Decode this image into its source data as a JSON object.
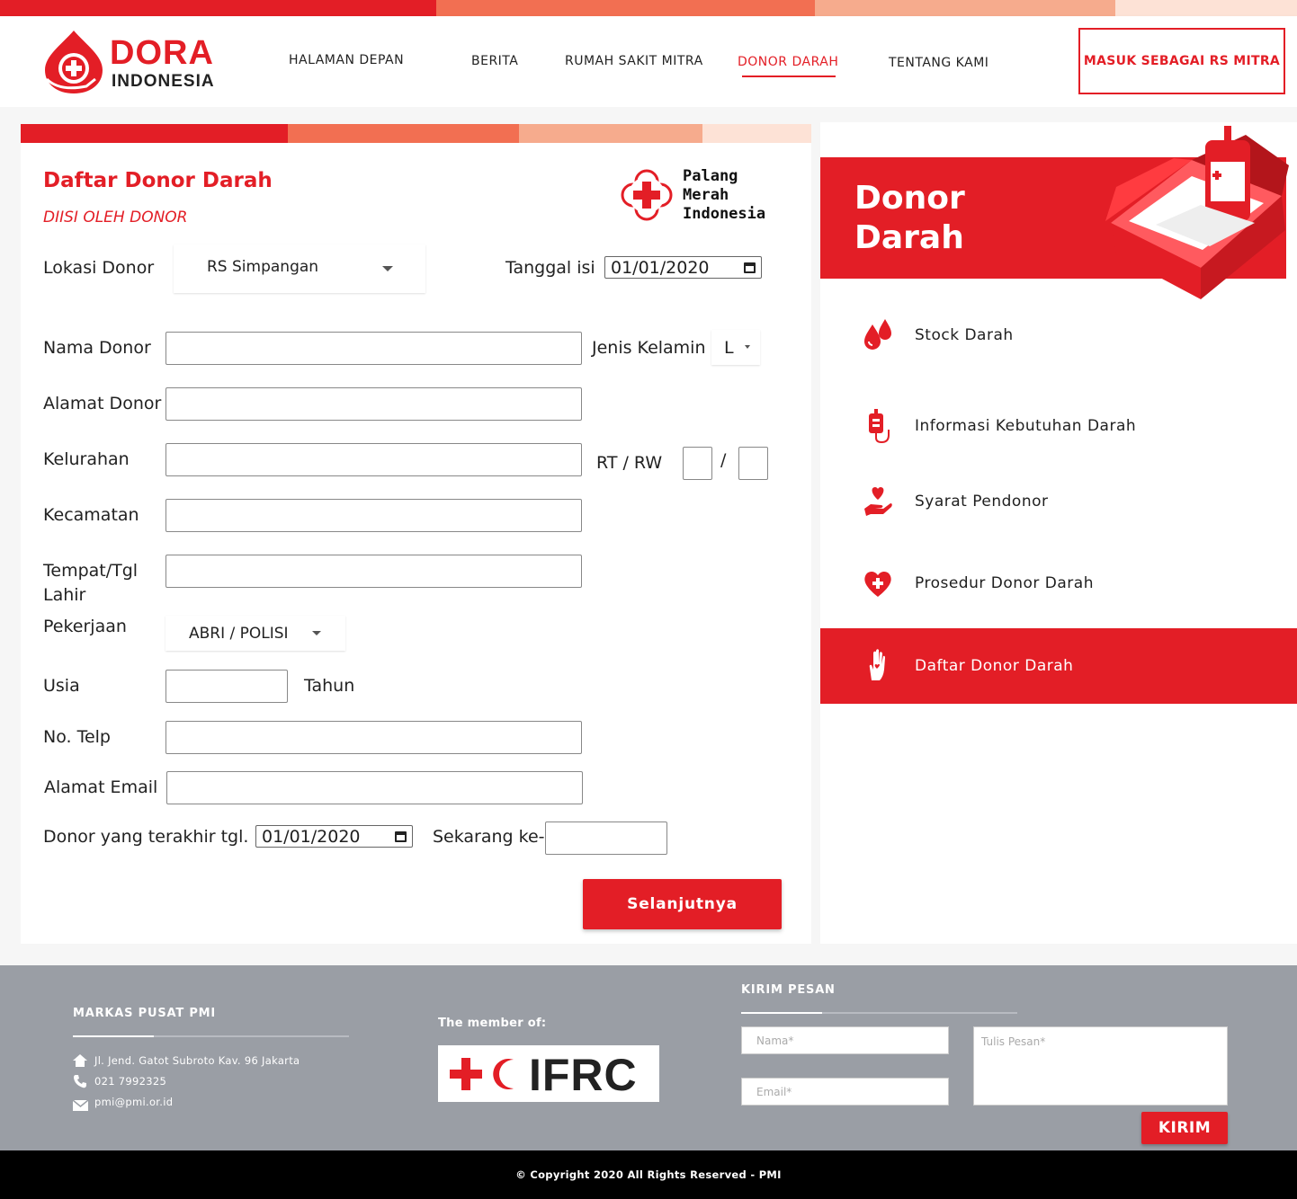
{
  "brand": {
    "name_line1": "DORA",
    "name_line2": "INDONESIA",
    "colors": {
      "primary": "#e31e26",
      "orange": "#f26f52",
      "peach": "#f6ab8d",
      "light": "#fde2d6",
      "footer_gray": "#9a9ea5"
    }
  },
  "nav": {
    "items": [
      {
        "label": "HALAMAN DEPAN"
      },
      {
        "label": "BERITA"
      },
      {
        "label": "RUMAH SAKIT MITRA"
      },
      {
        "label": "DONOR DARAH"
      },
      {
        "label": "TENTANG KAMI"
      }
    ],
    "active": "DONOR DARAH",
    "cta_label": "MASUK SEBAGAI RS MITRA"
  },
  "form": {
    "title": "Daftar Donor Darah",
    "subtitle": "DIISI OLEH DONOR",
    "org_logo": {
      "line1": "Palang",
      "line2": "Merah",
      "line3": "Indonesia"
    },
    "lokasi_label": "Lokasi Donor",
    "lokasi_value": "RS Simpangan",
    "tanggal_label": "Tanggal isi",
    "tanggal_value": "01/01/2020",
    "nama_label": "Nama Donor",
    "jk_label": "Jenis Kelamin",
    "jk_value": "L",
    "alamat_label": "Alamat Donor",
    "kelurahan_label": "Kelurahan",
    "rtrw_label": "RT / RW",
    "rtrw_sep": "/",
    "kecamatan_label": "Kecamatan",
    "ttl_label_1": "Tempat/Tgl",
    "ttl_label_2": "Lahir",
    "pekerjaan_label": "Pekerjaan",
    "pekerjaan_value": "ABRI / POLISI",
    "usia_label": "Usia",
    "usia_unit": "Tahun",
    "telp_label": "No. Telp",
    "email_label": "Alamat Email",
    "terakhir_label": "Donor yang terakhir tgl.",
    "terakhir_value": "01/01/2020",
    "sekarang_label": "Sekarang ke-",
    "submit_label": "Selanjutnya"
  },
  "sidebar": {
    "banner_title_1": "Donor",
    "banner_title_2": "Darah",
    "items": [
      {
        "label": "Stock Darah",
        "icon": "blood-drops-icon"
      },
      {
        "label": "Informasi Kebutuhan Darah",
        "icon": "blood-bag-icon"
      },
      {
        "label": "Syarat Pendonor",
        "icon": "heart-hand-icon"
      },
      {
        "label": "Prosedur Donor Darah",
        "icon": "heart-cross-icon"
      },
      {
        "label": "Daftar Donor Darah",
        "icon": "hand-icon",
        "active": true
      }
    ]
  },
  "footer": {
    "hq_title": "MARKAS PUSAT PMI",
    "address": "Jl. Jend. Gatot Subroto Kav. 96 Jakarta",
    "phone": "021 7992325",
    "email": "pmi@pmi.or.id",
    "member_label": "The member of:",
    "ifrc_text": "IFRC",
    "contact_title": "KIRIM PESAN",
    "name_placeholder": "Nama*",
    "email_placeholder": "Email*",
    "message_placeholder": "Tulis Pesan*",
    "send_label": "KIRIM",
    "copyright": "© Copyright 2020 All Rights Reserved - PMI"
  }
}
